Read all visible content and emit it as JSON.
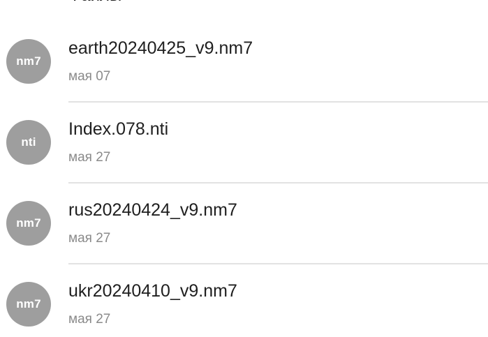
{
  "header": {
    "partial_label": "Файлы"
  },
  "files": [
    {
      "icon_text": "nm7",
      "name": "earth20240425_v9.nm7",
      "date": "мая 07"
    },
    {
      "icon_text": "nti",
      "name": "Index.078.nti",
      "date": "мая 27"
    },
    {
      "icon_text": "nm7",
      "name": "rus20240424_v9.nm7",
      "date": "мая 27"
    },
    {
      "icon_text": "nm7",
      "name": "ukr20240410_v9.nm7",
      "date": "мая 27"
    }
  ],
  "colors": {
    "icon_bg": "#9e9e9e",
    "title_text": "#1f1f1f",
    "date_text": "#8a8a8a",
    "divider": "#e2e2e2"
  }
}
